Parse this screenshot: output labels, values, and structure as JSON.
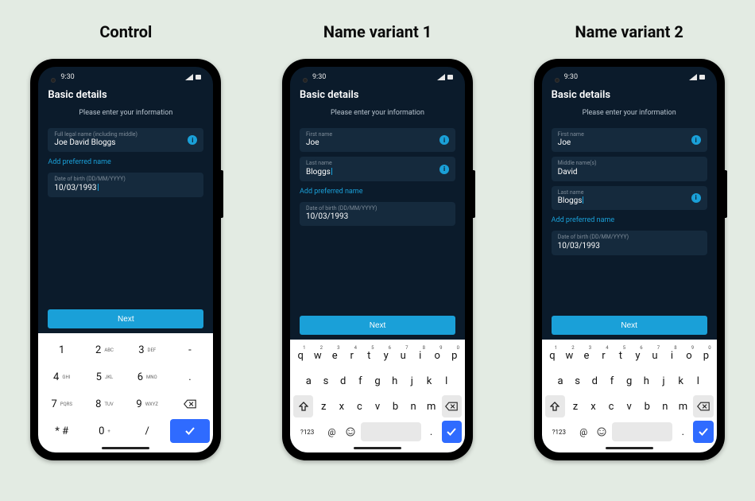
{
  "variants": {
    "control": {
      "title": "Control"
    },
    "v1": {
      "title": "Name variant 1"
    },
    "v2": {
      "title": "Name variant 2"
    }
  },
  "statusbar": {
    "time": "9:30"
  },
  "page": {
    "title": "Basic details",
    "subtitle": "Please enter your information",
    "next": "Next",
    "add_preferred": "Add preferred name"
  },
  "fields": {
    "full_name": {
      "label": "Full legal name (including middle)",
      "value": "Joe David Bloggs"
    },
    "first_name": {
      "label": "First name",
      "value": "Joe"
    },
    "middle_name": {
      "label": "Middle name(s)",
      "value": "David"
    },
    "last_name": {
      "label": "Last name",
      "value": "Bloggs"
    },
    "dob": {
      "label": "Date of birth (DD/MM/YYYY)",
      "value": "10/03/1993"
    }
  },
  "info_icon": "i",
  "numpad": {
    "rows": [
      [
        {
          "k": "1",
          "s": ""
        },
        {
          "k": "2",
          "s": "ABC"
        },
        {
          "k": "3",
          "s": "DEF"
        },
        {
          "k": "-",
          "s": ""
        }
      ],
      [
        {
          "k": "4",
          "s": "GHI"
        },
        {
          "k": "5",
          "s": "JKL"
        },
        {
          "k": "6",
          "s": "MNO"
        },
        {
          "k": ".",
          "s": ""
        }
      ],
      [
        {
          "k": "7",
          "s": "PQRS"
        },
        {
          "k": "8",
          "s": "TUV"
        },
        {
          "k": "9",
          "s": "WXYZ"
        },
        {
          "k": "del",
          "s": ""
        }
      ],
      [
        {
          "k": "* #",
          "s": ""
        },
        {
          "k": "0",
          "s": "+"
        },
        {
          "k": "/",
          "s": ""
        },
        {
          "k": "done",
          "s": ""
        }
      ]
    ]
  },
  "qwerty": {
    "row1": [
      {
        "k": "q",
        "n": "1"
      },
      {
        "k": "w",
        "n": "2"
      },
      {
        "k": "e",
        "n": "3"
      },
      {
        "k": "r",
        "n": "4"
      },
      {
        "k": "t",
        "n": "5"
      },
      {
        "k": "y",
        "n": "6"
      },
      {
        "k": "u",
        "n": "7"
      },
      {
        "k": "i",
        "n": "8"
      },
      {
        "k": "o",
        "n": "9"
      },
      {
        "k": "p",
        "n": "0"
      }
    ],
    "row2": [
      "a",
      "s",
      "d",
      "f",
      "g",
      "h",
      "j",
      "k",
      "l"
    ],
    "row3": [
      "z",
      "x",
      "c",
      "v",
      "b",
      "n",
      "m"
    ],
    "row4": {
      "symnum": "?123",
      "at": "@",
      "period": "."
    }
  }
}
